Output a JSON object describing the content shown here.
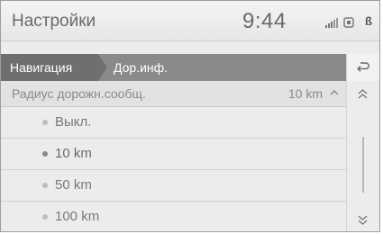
{
  "header": {
    "title": "Настройки",
    "time": "9:44"
  },
  "status_icons": [
    "signal-icon",
    "wifi-icon",
    "bluetooth-icon"
  ],
  "bluetooth_glyph": "ʙ",
  "breadcrumb": {
    "items": [
      "Навигация",
      "Дор.инф."
    ]
  },
  "back_icon": "back-arrow-icon",
  "setting": {
    "label": "Радиус дорожн.сообщ.",
    "value": "10 km"
  },
  "options": [
    {
      "label": "Выкл.",
      "selected": false
    },
    {
      "label": "10 km",
      "selected": true
    },
    {
      "label": "50 km",
      "selected": false
    },
    {
      "label": "100 km",
      "selected": false
    }
  ],
  "colors": {
    "header_bg": "#ececec",
    "breadcrumb_active": "#6f6f6f",
    "breadcrumb_bg": "#8a8a8a",
    "text": "#7a7a7a"
  }
}
